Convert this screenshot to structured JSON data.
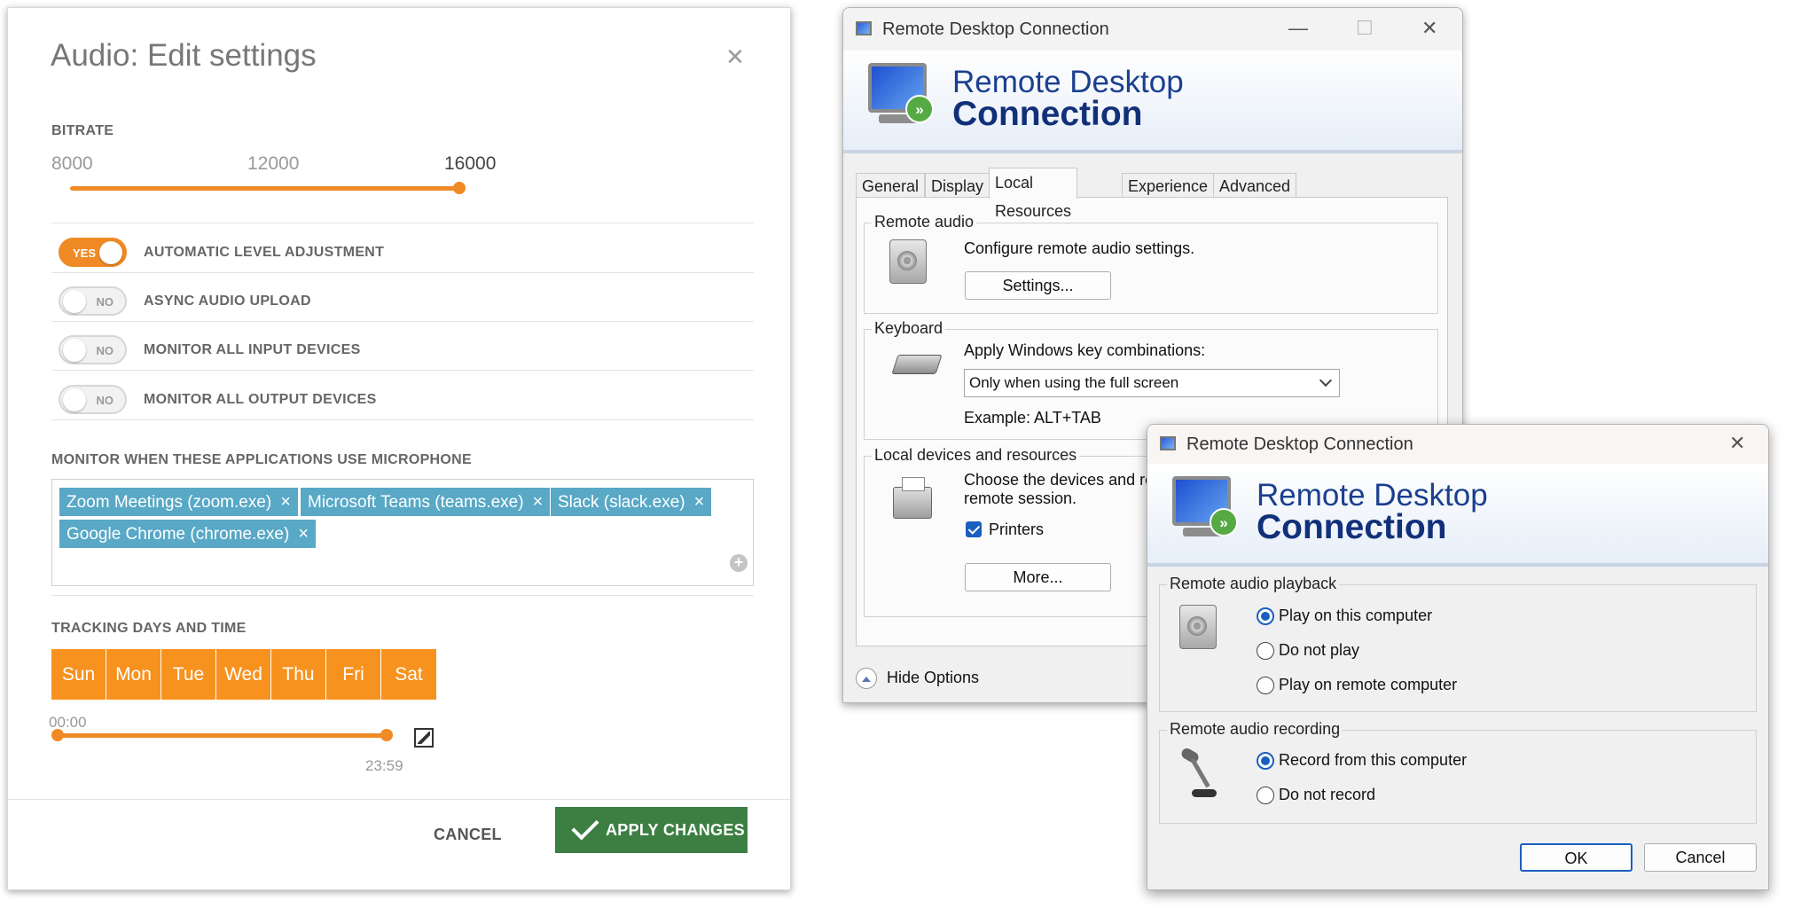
{
  "audio_dialog": {
    "title": "Audio: Edit settings",
    "close_symbol": "×",
    "bitrate": {
      "label": "BITRATE",
      "ticks": [
        "8000",
        "12000",
        "16000"
      ],
      "selected": "16000"
    },
    "toggles": [
      {
        "state_label": "YES",
        "on": true,
        "label": "AUTOMATIC LEVEL ADJUSTMENT"
      },
      {
        "state_label": "NO",
        "on": false,
        "label": "ASYNC AUDIO UPLOAD"
      },
      {
        "state_label": "NO",
        "on": false,
        "label": "MONITOR ALL INPUT DEVICES"
      },
      {
        "state_label": "NO",
        "on": false,
        "label": "MONITOR ALL OUTPUT DEVICES"
      }
    ],
    "apps_label": "MONITOR WHEN THESE APPLICATIONS USE MICROPHONE",
    "apps": [
      {
        "name": "Zoom Meetings (zoom.exe)",
        "remove": "×"
      },
      {
        "name": "Microsoft Teams (teams.exe)",
        "remove": "×"
      },
      {
        "name": "Slack (slack.exe)",
        "remove": "×"
      },
      {
        "name": "Google Chrome (chrome.exe)",
        "remove": "×"
      }
    ],
    "add_symbol": "+",
    "tracking_label": "TRACKING DAYS AND TIME",
    "days": [
      "Sun",
      "Mon",
      "Tue",
      "Wed",
      "Thu",
      "Fri",
      "Sat"
    ],
    "time_start": "00:00",
    "time_end": "23:59",
    "cancel_label": "CANCEL",
    "apply_label": "APPLY CHANGES",
    "accent_color": "#f08a24",
    "apply_color": "#3d7f42",
    "chip_color": "#58a8c6"
  },
  "rdc_main": {
    "window_title": "Remote Desktop Connection",
    "controls": {
      "minimize": "—",
      "maximize": "☐",
      "close": "✕"
    },
    "banner_line1": "Remote Desktop",
    "banner_line2": "Connection",
    "badge_symbol": "»",
    "tabs": [
      "General",
      "Display",
      "Local Resources",
      "Experience",
      "Advanced"
    ],
    "active_tab": "Local Resources",
    "remote_audio": {
      "title": "Remote audio",
      "text": "Configure remote audio settings.",
      "button": "Settings..."
    },
    "keyboard": {
      "title": "Keyboard",
      "text": "Apply Windows key combinations:",
      "select_value": "Only when using the full screen",
      "example": "Example: ALT+TAB"
    },
    "local_devices": {
      "title": "Local devices and resources",
      "text_line1": "Choose the devices and re",
      "text_line2": "remote session.",
      "printers_label": "Printers",
      "printers_checked": true,
      "more_button": "More..."
    },
    "hide_options": "Hide Options"
  },
  "rdc_audio": {
    "window_title": "Remote Desktop Connection",
    "close": "✕",
    "banner_line1": "Remote Desktop",
    "banner_line2": "Connection",
    "badge_symbol": "»",
    "playback": {
      "title": "Remote audio playback",
      "options": [
        "Play on this computer",
        "Do not play",
        "Play on remote computer"
      ],
      "selected": "Play on this computer"
    },
    "recording": {
      "title": "Remote audio recording",
      "options": [
        "Record from this computer",
        "Do not record"
      ],
      "selected": "Record from this computer"
    },
    "ok_label": "OK",
    "cancel_label": "Cancel"
  }
}
